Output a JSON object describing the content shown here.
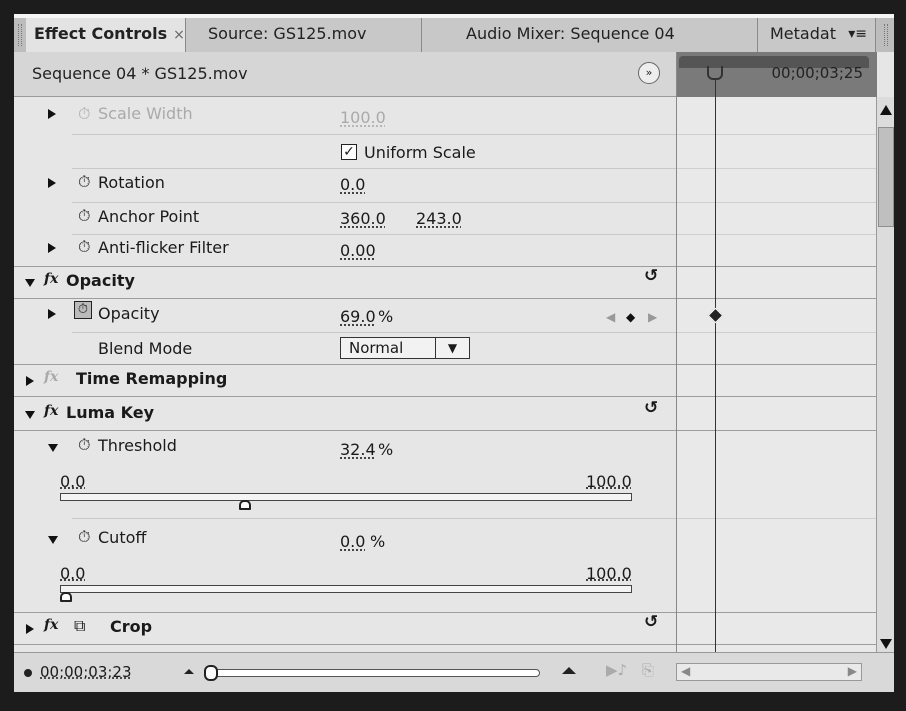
{
  "tabs": [
    {
      "label": "Effect Controls",
      "close": "×"
    },
    {
      "label": "Source: GS125.mov"
    },
    {
      "label": "Audio Mixer: Sequence 04"
    },
    {
      "label": "Metadat"
    }
  ],
  "panel_menu_icon": "panel-menu-icon",
  "header": {
    "title": "Sequence 04 * GS125.mov",
    "timecode": "00;00;03;25"
  },
  "rows": {
    "scale_width": {
      "label": "Scale Width",
      "value": "100.0"
    },
    "uniform_scale": {
      "label": "Uniform Scale",
      "checked": true
    },
    "rotation": {
      "label": "Rotation",
      "value": "0.0"
    },
    "anchor_point": {
      "label": "Anchor Point",
      "x": "360.0",
      "y": "243.0"
    },
    "anti_flicker": {
      "label": "Anti-flicker Filter",
      "value": "0.00"
    },
    "opacity_section": {
      "label": "Opacity"
    },
    "opacity": {
      "label": "Opacity",
      "value": "69.0",
      "unit": "%"
    },
    "blend_mode": {
      "label": "Blend Mode",
      "value": "Normal"
    },
    "time_remapping": {
      "label": "Time Remapping"
    },
    "luma_key": {
      "label": "Luma Key"
    },
    "threshold": {
      "label": "Threshold",
      "value": "32.4",
      "unit": "%",
      "min": "0.0",
      "max": "100.0",
      "level": 0.324
    },
    "cutoff": {
      "label": "Cutoff",
      "value": "0.0",
      "unit": "%",
      "min": "0.0",
      "max": "100.0",
      "level": 0.0
    },
    "crop": {
      "label": "Crop"
    }
  },
  "bottom": {
    "timecode": "00;00;03;23"
  }
}
